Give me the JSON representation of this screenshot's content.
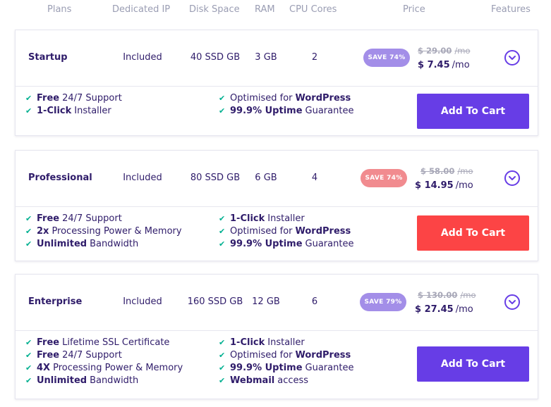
{
  "header": {
    "plans": "Plans",
    "dedicated_ip": "Dedicated IP",
    "disk_space": "Disk Space",
    "ram": "RAM",
    "cpu_cores": "CPU Cores",
    "price": "Price",
    "features": "Features"
  },
  "colors": {
    "purple": "#673de6",
    "red": "#fc4445",
    "badge_purple": "#a38ee8",
    "badge_red": "#f18b8f",
    "check": "#00b090",
    "text": "#2f1c6a"
  },
  "plans": [
    {
      "name": "Startup",
      "dedicated_ip": "Included",
      "disk": "40 SSD GB",
      "ram": "3 GB",
      "cpu": "2",
      "badge": "SAVE 74%",
      "old_price": "$ 29.00",
      "old_unit": "/mo",
      "new_price": "$ 7.45",
      "new_unit": "/mo",
      "cart_label": "Add To Cart",
      "features_left": [
        {
          "strong": "Free",
          "text": "24/7 Support"
        },
        {
          "strong": "1-Click",
          "text": "Installer"
        }
      ],
      "features_right": [
        {
          "pre": "Optimised for",
          "strong": "WordPress",
          "text": ""
        },
        {
          "strong": "99.9% Uptime",
          "text": "Guarantee"
        }
      ]
    },
    {
      "name": "Professional",
      "dedicated_ip": "Included",
      "disk": "80 SSD GB",
      "ram": "6 GB",
      "cpu": "4",
      "badge": "SAVE 74%",
      "old_price": "$ 58.00",
      "old_unit": "/mo",
      "new_price": "$ 14.95",
      "new_unit": "/mo",
      "cart_label": "Add To Cart",
      "features_left": [
        {
          "strong": "Free",
          "text": "24/7 Support"
        },
        {
          "strong": "2x",
          "text": "Processing Power & Memory"
        },
        {
          "strong": "Unlimited",
          "text": "Bandwidth"
        }
      ],
      "features_right": [
        {
          "strong": "1-Click",
          "text": "Installer"
        },
        {
          "pre": "Optimised for",
          "strong": "WordPress",
          "text": ""
        },
        {
          "strong": "99.9% Uptime",
          "text": "Guarantee"
        }
      ]
    },
    {
      "name": "Enterprise",
      "dedicated_ip": "Included",
      "disk": "160 SSD GB",
      "ram": "12 GB",
      "cpu": "6",
      "badge": "SAVE 79%",
      "old_price": "$ 130.00",
      "old_unit": "/mo",
      "new_price": "$ 27.45",
      "new_unit": "/mo",
      "cart_label": "Add To Cart",
      "features_left": [
        {
          "strong": "Free",
          "text": "Lifetime SSL Certificate"
        },
        {
          "strong": "Free",
          "text": "24/7 Support"
        },
        {
          "strong": "4X",
          "text": "Processing Power & Memory"
        },
        {
          "strong": "Unlimited",
          "text": "Bandwidth"
        }
      ],
      "features_right": [
        {
          "strong": "1-Click",
          "text": "Installer"
        },
        {
          "pre": "Optimised for",
          "strong": "WordPress",
          "text": ""
        },
        {
          "strong": "99.9% Uptime",
          "text": "Guarantee"
        },
        {
          "strong": "Webmail",
          "text": "access"
        }
      ]
    }
  ]
}
